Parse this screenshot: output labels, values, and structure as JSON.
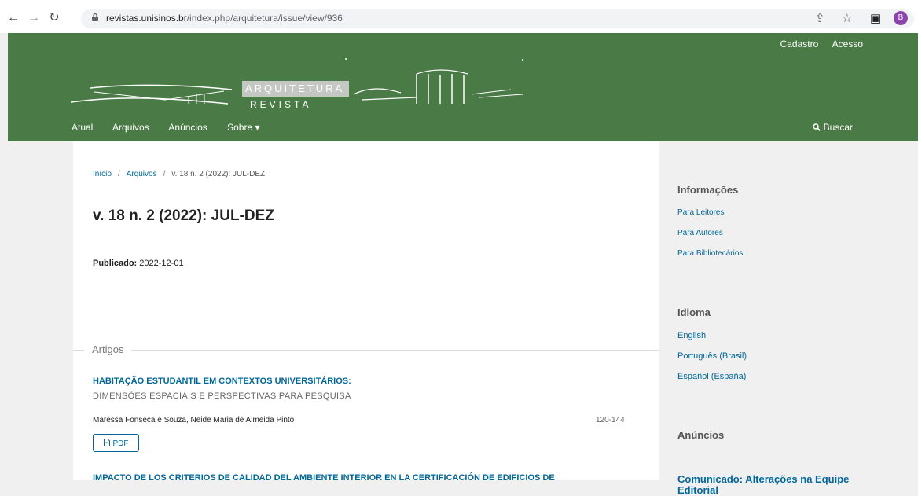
{
  "browser": {
    "url_host": "revistas.unisinos.br",
    "url_path": "/index.php/arquitetura/issue/view/936",
    "avatar_letter": "B"
  },
  "header": {
    "user_links": [
      "Cadastro",
      "Acesso"
    ],
    "logo_main": "ARQUITETURA",
    "logo_sub": "REVISTA",
    "nav": [
      "Atual",
      "Arquivos",
      "Anúncios",
      "Sobre ▾"
    ],
    "search": "Buscar"
  },
  "breadcrumb": {
    "home": "Início",
    "archives": "Arquivos",
    "separator": "/",
    "current": "v. 18 n. 2 (2022): JUL-DEZ"
  },
  "issue": {
    "title": "v. 18 n. 2 (2022): JUL-DEZ",
    "published_label": "Publicado:",
    "published_date": "2022-12-01"
  },
  "section": {
    "label": "Artigos"
  },
  "articles": [
    {
      "title": "HABITAÇÃO ESTUDANTIL EM CONTEXTOS UNIVERSITÁRIOS:",
      "subtitle": "DIMENSÕES ESPACIAIS E PERSPECTIVAS PARA PESQUISA",
      "authors": "Maressa Fonseca e Souza, Neide Maria de Almeida Pinto",
      "pages": "120-144",
      "galley": "PDF"
    },
    {
      "title": "IMPACTO DE LOS CRITERIOS DE CALIDAD DEL AMBIENTE INTERIOR EN LA CERTIFICACIÓN DE EDIFICIOS DE"
    }
  ],
  "sidebar": {
    "info_title": "Informações",
    "info_links": [
      "Para Leitores",
      "Para Autores",
      "Para Bibliotecários"
    ],
    "lang_title": "Idioma",
    "lang_links": [
      "English",
      "Português (Brasil)",
      "Español (España)"
    ],
    "announce_title": "Anúncios",
    "announce_item": "Comunicado: Alterações na Equipe Editorial"
  },
  "colors": {
    "header_green": "#4a7a45",
    "link_blue": "#006798"
  }
}
